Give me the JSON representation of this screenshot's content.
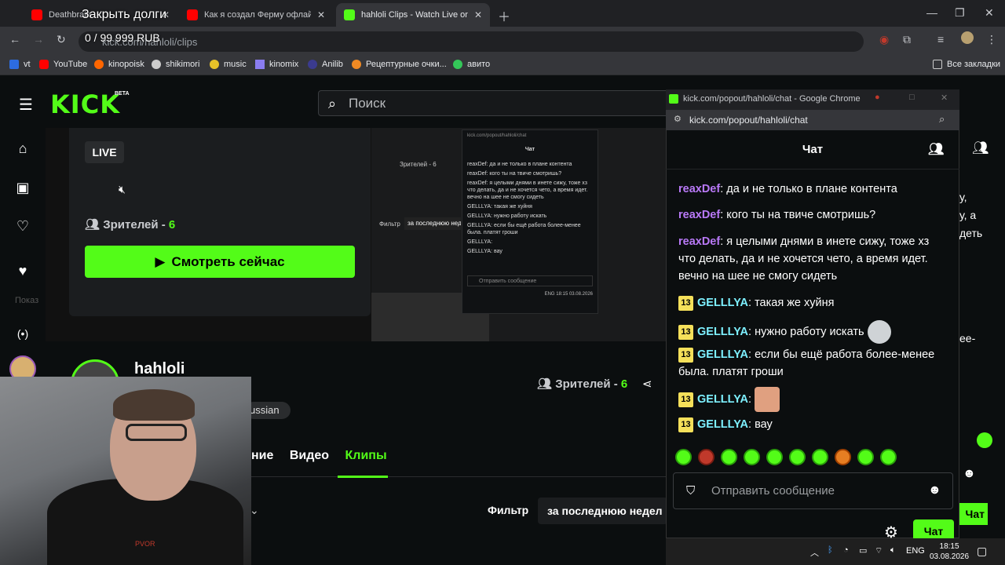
{
  "browser": {
    "tabs": [
      {
        "title": "Deathbrain",
        "color": "#ff0000"
      },
      {
        "title": "Как я создал Ферму офлайн а",
        "color": "#ff0000"
      },
      {
        "title": "hahloli Clips - Watch Live on Ki",
        "color": "#53fc18"
      }
    ],
    "url": "kick.com/hahloli/clips",
    "bookmarks": [
      "vt",
      "YouTube",
      "kinopoisk",
      "shikimori",
      "music",
      "kinomix",
      "Anilib",
      "Рецептурные очки...",
      "авито"
    ],
    "all_bookmarks": "Все закладки"
  },
  "overlay": {
    "title": "Закрыть долги",
    "progress": "0 / 99 999 RUB"
  },
  "kick": {
    "logo": "KICK",
    "beta": "BETA",
    "search_placeholder": "Поиск",
    "live": "LIVE",
    "viewers_label": "Зрителей - ",
    "viewers_count": "6",
    "watch_now": "Смотреть сейчас",
    "channel": "hahloli",
    "lang": "ussian",
    "tabs": [
      "ние",
      "Видео",
      "Клипы"
    ],
    "filter_label": "Фильтр",
    "filter_value": "за последнюю недел",
    "sidebar_cut": "Показ"
  },
  "mini_chat": {
    "url": "kick.com/popout/hahloli/chat",
    "title": "Чат",
    "viewers": "Зрителей - 6",
    "filter": "Фильтр",
    "filter_value": "за последнюю неделю",
    "input": "Отправить сообщение",
    "lines": [
      "reaxDef: да и не только в плане контента",
      "reaxDef: кого ты на твиче смотришь?",
      "reaxDef: я целыми днями в инете сижу, тоже хз что делать, да и не хочется чето, а время идет. вечно на шее не смогу сидеть",
      "GELLLYA: такая же хуйня",
      "GELLLYA: нужно работу искать",
      "GELLLYA: если бы ещё работа более-менее была. платят гроши",
      "GELLLYA:",
      "GELLLYA: вау"
    ],
    "clock": "18:15",
    "date": "03.08.2026",
    "lang": "ENG"
  },
  "popout": {
    "window_title": "kick.com/popout/hahloli/chat - Google Chrome",
    "url": "kick.com/popout/hahloli/chat",
    "header": "Чат",
    "messages": [
      {
        "user": "reaxDef",
        "text": "да и не только в плане контента",
        "badge": ""
      },
      {
        "user": "reaxDef",
        "text": "кого ты на твиче смотришь?",
        "badge": ""
      },
      {
        "user": "reaxDef",
        "text": "я целыми днями в инете сижу, тоже хз что делать, да и не хочется чето, а время идет. вечно на шее не смогу сидеть",
        "badge": ""
      },
      {
        "user": "GELLLYA",
        "text": "такая же хуйня",
        "badge": "13"
      },
      {
        "user": "GELLLYA",
        "text": "нужно работу искать",
        "badge": "13"
      },
      {
        "user": "GELLLYA",
        "text": "если бы ещё работа более-менее была. платят гроши",
        "badge": "13"
      },
      {
        "user": "GELLLYA",
        "text": "",
        "badge": "13"
      },
      {
        "user": "GELLLYA",
        "text": "вау",
        "badge": "13"
      }
    ],
    "input_placeholder": "Отправить сообщение",
    "chat_button": "Чат"
  },
  "right_col": {
    "fragments": [
      "у,",
      "у, а",
      "деть",
      "ее-"
    ],
    "chat_button": "Чат"
  },
  "taskbar": {
    "lang": "ENG",
    "time": "18:15",
    "date": "03.08.2026"
  },
  "webcam": {
    "shirt_text": "PVOR"
  },
  "colors": {
    "kick_green": "#53fc18",
    "reax": "#b979f8",
    "gellya": "#7df0ff",
    "badge": "#f5e05a"
  }
}
